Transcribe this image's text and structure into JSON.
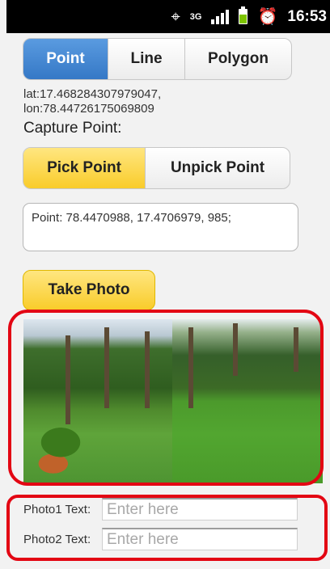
{
  "status_bar": {
    "network": "3G",
    "time": "16:53",
    "icons": [
      "gps-icon",
      "signal-icon",
      "battery-icon",
      "alarm-icon"
    ]
  },
  "geometry_tabs": {
    "items": [
      "Point",
      "Line",
      "Polygon"
    ],
    "selected": "Point"
  },
  "location": {
    "lat_text": "lat:17.468284307979047,",
    "lon_text": "lon:78.44726175069809"
  },
  "capture_label": "Capture Point:",
  "pick_buttons": {
    "pick": "Pick Point",
    "unpick": "Unpick Point",
    "selected": "Pick Point"
  },
  "point_text": "Point: 78.4470988, 17.4706979, 985;",
  "take_photo_label": "Take Photo",
  "photos": {
    "count": 2
  },
  "photo_text": {
    "photo1_label": "Photo1 Text:",
    "photo2_label": "Photo2 Text:",
    "photo1_placeholder": "Enter here",
    "photo2_placeholder": "Enter here"
  },
  "colors": {
    "accent_blue": "#3578c6",
    "accent_yellow": "#f9cc2a",
    "highlight_red": "#e30613"
  }
}
